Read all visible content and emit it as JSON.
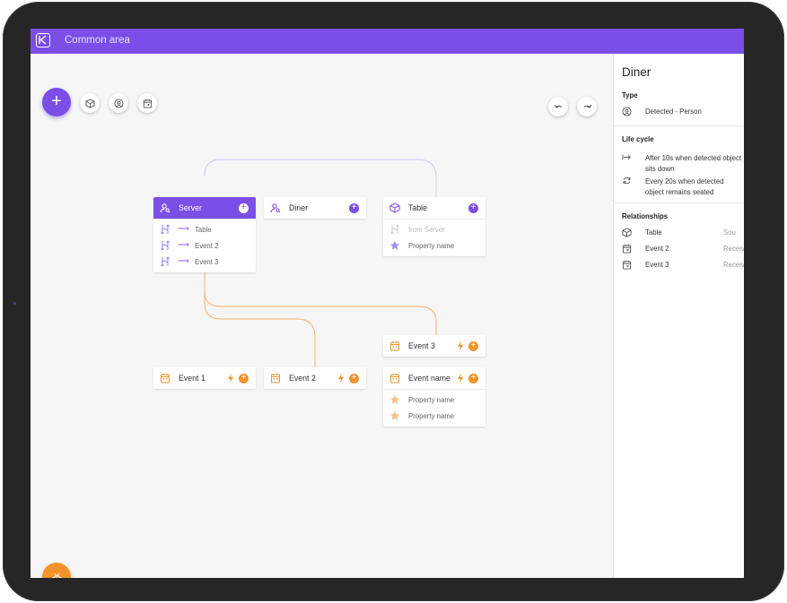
{
  "app": {
    "title": "Common area"
  },
  "toolbar": {
    "add": "+",
    "tools": [
      "object-icon",
      "person-icon",
      "calendar-icon"
    ],
    "undo": "undo-icon",
    "redo": "redo-icon"
  },
  "colors": {
    "accent": "#7b4ee8",
    "event": "#f2932c",
    "canvas": "#f6f6f7"
  },
  "nodes": {
    "server": {
      "label": "Server",
      "rows": [
        {
          "arrow": "⟶",
          "label": "Table"
        },
        {
          "arrow": "⟶",
          "label": "Event 2"
        },
        {
          "arrow": "⟶",
          "label": "Event 3"
        }
      ]
    },
    "diner": {
      "label": "Diner"
    },
    "table": {
      "label": "Table",
      "rows": [
        {
          "label": "from Server"
        },
        {
          "label": "Property name"
        }
      ]
    },
    "event1": {
      "label": "Event 1"
    },
    "event2": {
      "label": "Event 2"
    },
    "event3": {
      "label": "Event 3"
    },
    "event_name": {
      "label": "Event name",
      "rows": [
        {
          "label": "Property name"
        },
        {
          "label": "Property name"
        }
      ]
    }
  },
  "panel": {
    "title": "Diner",
    "type": {
      "heading": "Type",
      "value": "Detected - Person"
    },
    "lifecycle": {
      "heading": "Life cycle",
      "items": [
        "After 10s when detected object sits down",
        "Every 20s when detected object remains seated"
      ]
    },
    "relationships": {
      "heading": "Relationships",
      "items": [
        {
          "label": "Table",
          "aside": "Sou"
        },
        {
          "label": "Event 2",
          "aside": "Receiv"
        },
        {
          "label": "Event 3",
          "aside": "Receiv"
        }
      ]
    }
  }
}
